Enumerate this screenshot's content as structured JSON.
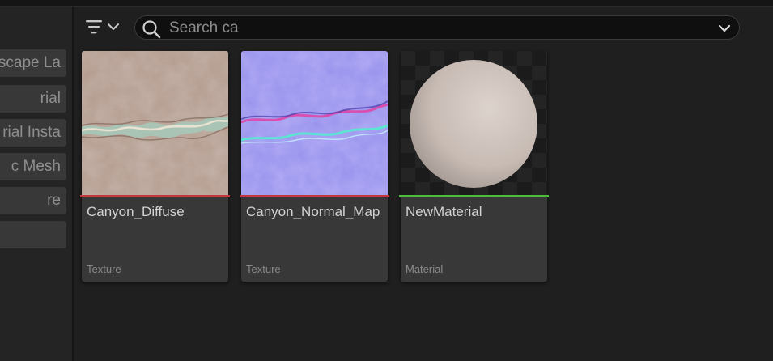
{
  "search": {
    "value": "",
    "placeholder": "Search ca"
  },
  "filter_button": {
    "icon": "filter-icon",
    "dropdown_icon": "chevron-down-icon"
  },
  "sidebar": {
    "chips": [
      {
        "label": "scape La"
      },
      {
        "label": "rial"
      },
      {
        "label": "rial Insta"
      },
      {
        "label": "c Mesh"
      },
      {
        "label": "re"
      },
      {
        "label": ""
      }
    ]
  },
  "assets": [
    {
      "name": "Canyon_Diffuse",
      "type": "Texture",
      "type_color": "#c0393f"
    },
    {
      "name": "Canyon_Normal_Map",
      "type": "Texture",
      "type_color": "#c0393f"
    },
    {
      "name": "NewMaterial",
      "type": "Material",
      "type_color": "#4fbd3c"
    }
  ],
  "colors": {
    "background": "#1f1f1f",
    "tile": "#383838",
    "search_bg": "#0f0f0f"
  }
}
